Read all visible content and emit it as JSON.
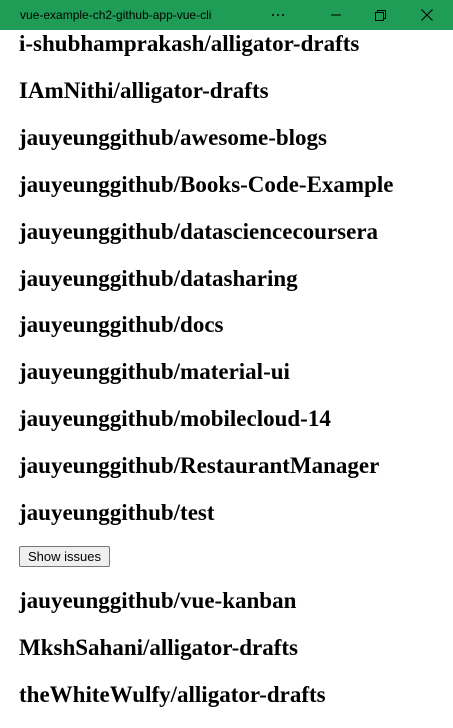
{
  "window": {
    "title": "vue-example-ch2-github-app-vue-cli",
    "titlebar_color": "#1f9d57",
    "controls": [
      "more-icon",
      "minimize-icon",
      "restore-icon",
      "close-icon"
    ]
  },
  "repos": [
    {
      "name": "i-shubhamprakash/alligator-drafts"
    },
    {
      "name": "IAmNithi/alligator-drafts"
    },
    {
      "name": "jauyeunggithub/awesome-blogs"
    },
    {
      "name": "jauyeunggithub/Books-Code-Example"
    },
    {
      "name": "jauyeunggithub/datasciencecoursera"
    },
    {
      "name": "jauyeunggithub/datasharing"
    },
    {
      "name": "jauyeunggithub/docs"
    },
    {
      "name": "jauyeunggithub/material-ui"
    },
    {
      "name": "jauyeunggithub/mobilecloud-14"
    },
    {
      "name": "jauyeunggithub/RestaurantManager"
    },
    {
      "name": "jauyeunggithub/test"
    },
    {
      "name": "jauyeunggithub/vue-kanban"
    },
    {
      "name": "MkshSahani/alligator-drafts"
    },
    {
      "name": "theWhiteWulfy/alligator-drafts"
    }
  ],
  "show_issues_label": "Show issues"
}
